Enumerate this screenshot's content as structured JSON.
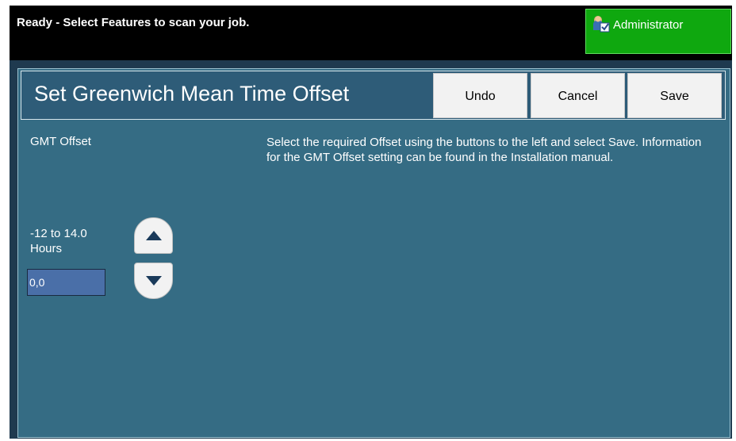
{
  "status_bar": {
    "message": "Ready - Select Features to scan your job.",
    "user_label": "Administrator",
    "user_icon": "administrator-icon",
    "user_color": "#0fa80f"
  },
  "dialog": {
    "title": "Set Greenwich Mean Time Offset",
    "buttons": {
      "undo": "Undo",
      "cancel": "Cancel",
      "save": "Save"
    }
  },
  "gmt": {
    "label": "GMT Offset",
    "range_line1": "-12 to 14.0",
    "range_line2": "Hours",
    "value": "0,0",
    "up_icon": "triangle-up-icon",
    "down_icon": "triangle-down-icon"
  },
  "info": {
    "text": "Select the required Offset using the buttons to the left and select Save. Information for the GMT Offset setting can be found in the Installation manual."
  },
  "colors": {
    "panel": "#356c84",
    "title_bar": "#2e5c78",
    "button": "#f2f2f2"
  }
}
